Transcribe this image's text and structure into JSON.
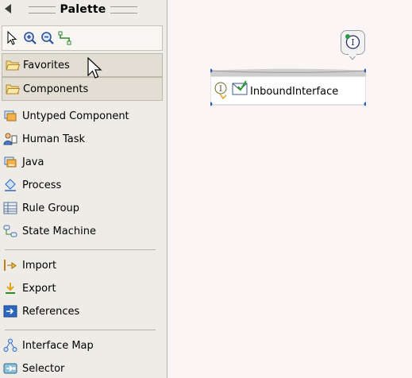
{
  "palette": {
    "title": "Palette",
    "drawers": [
      {
        "label": "Favorites",
        "icon": "folder-icon"
      },
      {
        "label": "Components",
        "icon": "folder-icon"
      }
    ],
    "entries": [
      {
        "label": "Untyped Component",
        "icon": "untyped-component-icon"
      },
      {
        "label": "Human Task",
        "icon": "human-task-icon"
      },
      {
        "label": "Java",
        "icon": "java-icon"
      },
      {
        "label": "Process",
        "icon": "process-icon"
      },
      {
        "label": "Rule Group",
        "icon": "rule-group-icon"
      },
      {
        "label": "State Machine",
        "icon": "state-machine-icon"
      },
      {
        "label": "Import",
        "icon": "import-icon"
      },
      {
        "label": "Export",
        "icon": "export-icon"
      },
      {
        "label": "References",
        "icon": "references-icon"
      },
      {
        "label": "Interface Map",
        "icon": "interface-map-icon"
      },
      {
        "label": "Selector",
        "icon": "selector-icon"
      }
    ],
    "tools": [
      "select-arrow-icon",
      "zoom-in-icon",
      "zoom-out-icon",
      "wire-tool-icon"
    ]
  },
  "canvas": {
    "component": {
      "name": "InboundInterface",
      "interface_marker": "I",
      "callout_marker": "I"
    }
  },
  "colors": {
    "canvas_bg": "#fbf5f5",
    "palette_bg": "#eeece6",
    "selection_handle": "#2f5fbf"
  }
}
